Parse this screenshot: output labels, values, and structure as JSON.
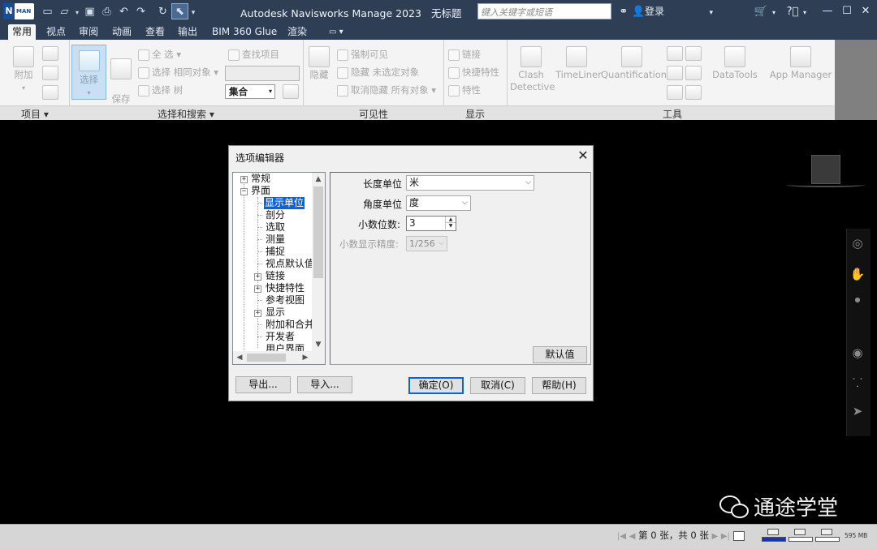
{
  "titlebar": {
    "app_logo_letter": "N",
    "app_logo_sub": "MAN",
    "app_name": "Autodesk Navisworks Manage 2023",
    "file_name": "无标题",
    "search_placeholder": "键入关键字或短语",
    "login_label": "登录"
  },
  "tabs": [
    "常用",
    "视点",
    "审阅",
    "动画",
    "查看",
    "输出",
    "BIM 360 Glue",
    "渲染"
  ],
  "ribbon": {
    "project_panel": {
      "title": "项目",
      "append_label": "附加"
    },
    "select_panel": {
      "title": "选择和搜索",
      "select_label": "选择",
      "save_label": "保存\n选择",
      "select_all": "全 选",
      "select_same": "选择 相同对象",
      "select_tree": "选择 树",
      "find_items": "查找项目",
      "sets_label": "集合"
    },
    "visibility_panel": {
      "title": "可见性",
      "hide_label": "隐藏",
      "require": "强制可见",
      "hide_unselected": "隐藏 未选定对象",
      "unhide_all": "取消隐藏 所有对象"
    },
    "display_panel": {
      "title": "显示",
      "links": "链接",
      "quick_props": "快捷特性",
      "properties": "特性"
    },
    "tools_panel": {
      "title": "工具",
      "clash_line1": "Clash",
      "clash_line2": "Detective",
      "timeliner": "TimeLiner",
      "quantification": "Quantification",
      "datatools": "DataTools",
      "app_manager": "App Manager"
    }
  },
  "dialog": {
    "title": "选项编辑器",
    "tree": [
      {
        "label": "常规",
        "expander": "+"
      },
      {
        "label": "界面",
        "expander": "−"
      },
      {
        "label": "显示单位",
        "selected": true
      },
      {
        "label": "剖分"
      },
      {
        "label": "选取"
      },
      {
        "label": "测量"
      },
      {
        "label": "捕捉"
      },
      {
        "label": "视点默认值"
      },
      {
        "label": "链接",
        "expander": "+"
      },
      {
        "label": "快捷特性",
        "expander": "+"
      },
      {
        "label": "参考视图"
      },
      {
        "label": "显示",
        "expander": "+"
      },
      {
        "label": "附加和合并"
      },
      {
        "label": "开发者"
      },
      {
        "label": "用户界面"
      }
    ],
    "fields": {
      "length_unit_label": "长度单位",
      "length_unit_value": "米",
      "angle_unit_label": "角度单位",
      "angle_unit_value": "度",
      "decimal_places_label": "小数位数:",
      "decimal_places_value": "3",
      "decimal_precision_label": "小数显示精度:",
      "decimal_precision_value": "1/256"
    },
    "defaults_button": "默认值",
    "export_button": "导出...",
    "import_button": "导入...",
    "ok_button": "确定(O)",
    "cancel_button": "取消(C)",
    "help_button": "帮助(H)"
  },
  "watermark": "通途学堂",
  "statusbar": {
    "sheet_info": "第 0 张，共 0 张",
    "memory": "595 MB",
    "perf_levels": [
      1.0,
      0.0,
      0.0
    ]
  },
  "colors": {
    "titlebar_bg": "#2e3e55",
    "selection_blue": "#0a64d8",
    "perf_fill": "#1f2fb8"
  }
}
